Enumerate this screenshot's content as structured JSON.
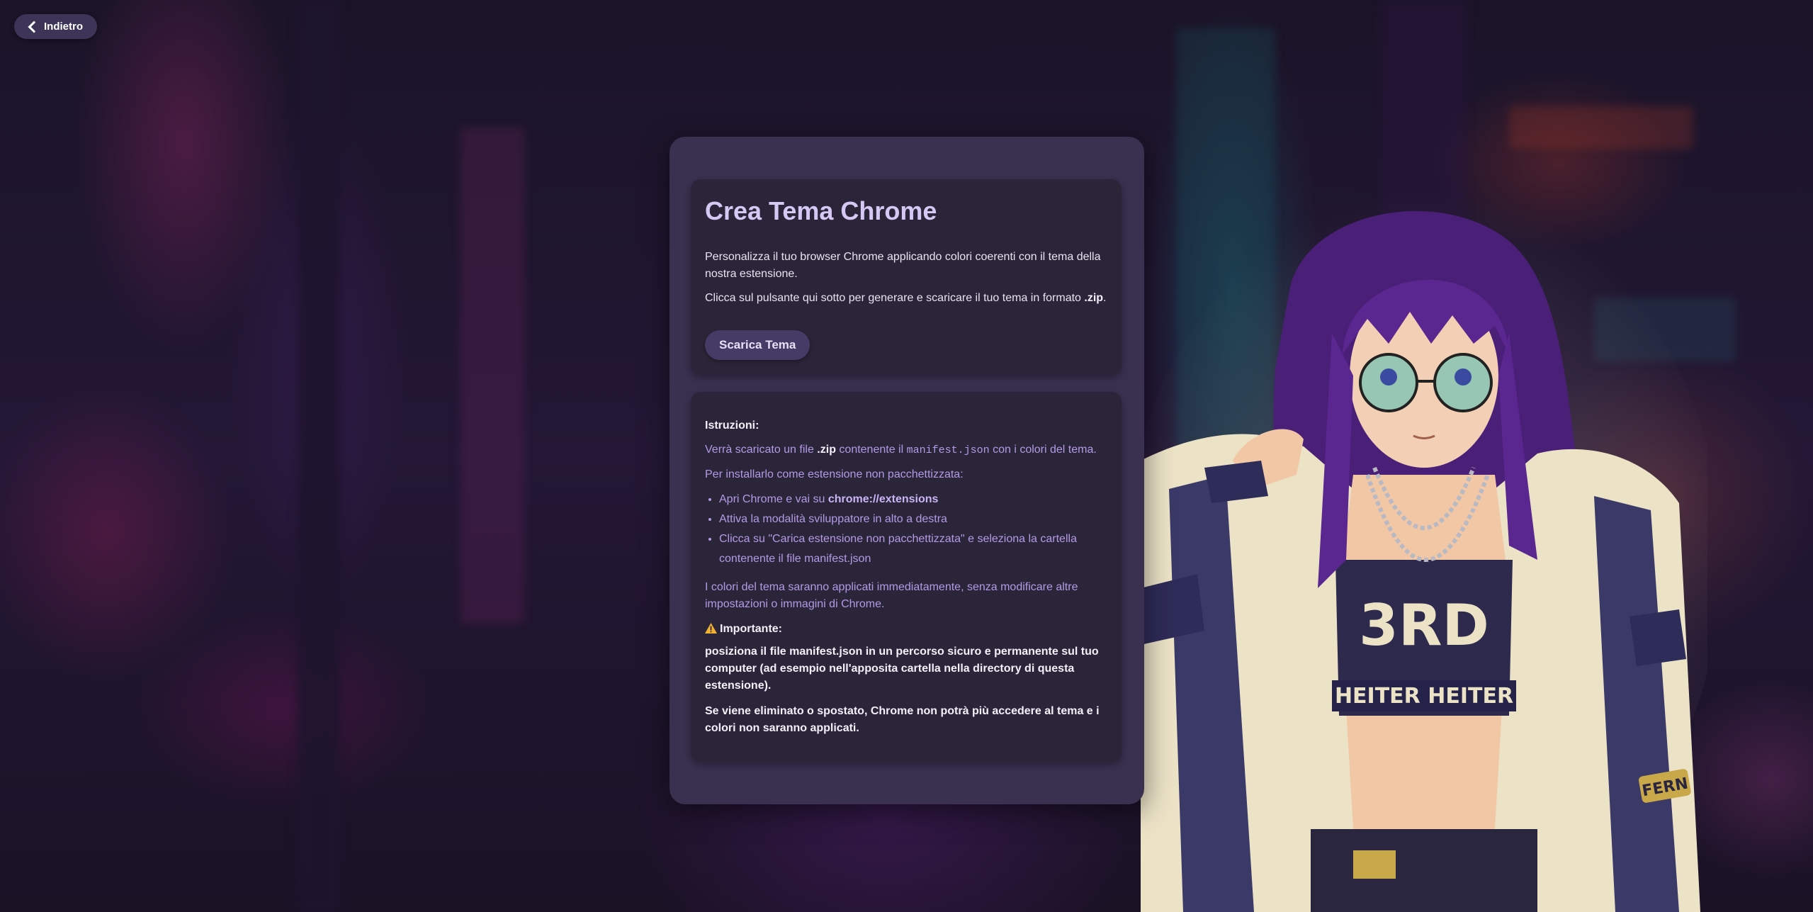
{
  "header": {
    "back_label": "Indietro"
  },
  "hero": {
    "title": "Crea Tema Chrome",
    "intro": "Personalizza il tuo browser Chrome applicando colori coerenti con il tema della nostra estensione.",
    "instruction_prefix": "Clicca sul pulsante qui sotto per generare e scaricare il tuo tema in formato ",
    "instruction_format": ".zip",
    "instruction_suffix": ".",
    "download_label": "Scarica Tema"
  },
  "instructions": {
    "heading": "Istruzioni:",
    "line1_a": "Verrà scaricato un file ",
    "line1_zip": ".zip",
    "line1_b": " contenente il ",
    "line1_manifest": "manifest.json",
    "line1_c": " con i colori del tema.",
    "line2": "Per installarlo come estensione non pacchettizzata:",
    "step1_a": "Apri Chrome e vai su ",
    "step1_b": "chrome://extensions",
    "step2": "Attiva la modalità sviluppatore in alto a destra",
    "step3": "Clicca su \"Carica estensione non pacchettizzata\" e seleziona la cartella contenente il file manifest.json",
    "note": "I colori del tema saranno applicati immediatamente, senza modificare altre impostazioni o immagini di Chrome.",
    "important_icon": "warning-icon",
    "important_label": "Importante:",
    "important1": "posiziona il file manifest.json in un percorso sicuro e permanente sul tuo computer (ad esempio nell'apposita cartella nella directory di questa estensione).",
    "important2": "Se viene eliminato o spostato, Chrome non potrà più accedere al tema e i colori non saranno applicati."
  },
  "theme": {
    "panel_color": "#3a3150",
    "card_color": "#2a2538",
    "accent": "#b49ae6",
    "title_color": "#d6c8f5"
  }
}
